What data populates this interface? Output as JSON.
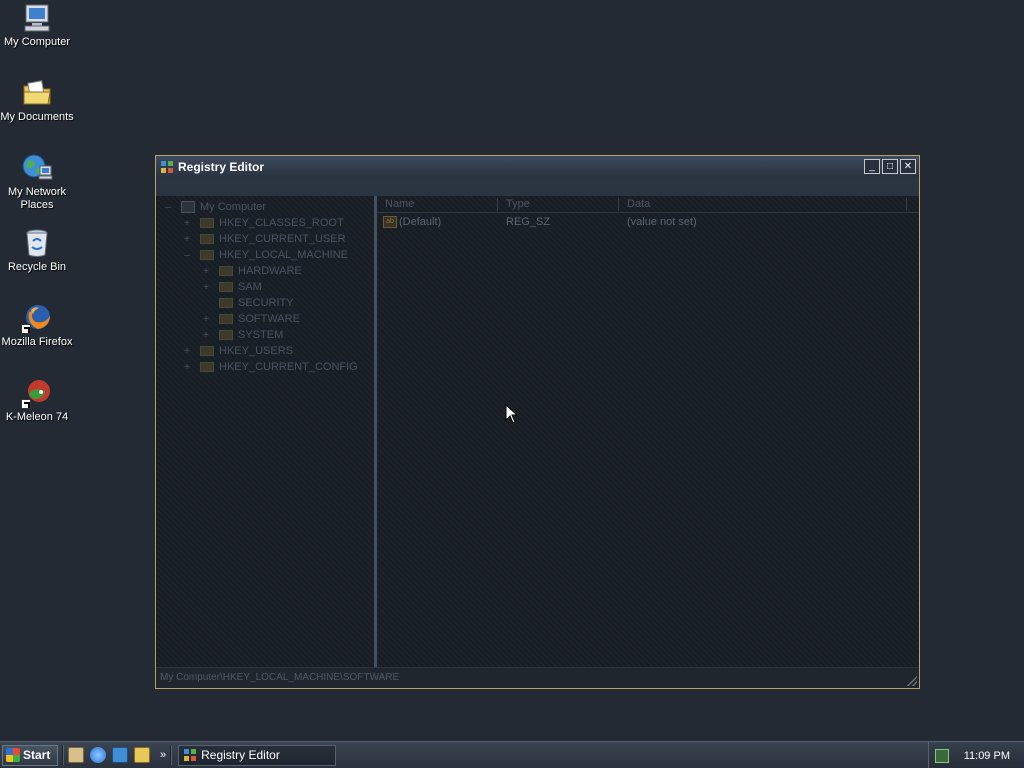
{
  "desktop": {
    "icons": [
      {
        "label": "My Computer",
        "icon": "my-computer-icon"
      },
      {
        "label": "My Documents",
        "icon": "my-documents-icon"
      },
      {
        "label": "My Network Places",
        "icon": "network-places-icon"
      },
      {
        "label": "Recycle Bin",
        "icon": "recycle-bin-icon"
      },
      {
        "label": "Mozilla Firefox",
        "icon": "firefox-icon"
      },
      {
        "label": "K-Meleon 74",
        "icon": "k-meleon-icon"
      }
    ]
  },
  "window": {
    "title": "Registry Editor",
    "controls": {
      "minimize": "_",
      "maximize": "□",
      "close": "✕"
    },
    "tree": [
      {
        "label": "My Computer",
        "expander": "–",
        "level": 0
      },
      {
        "label": "HKEY_CLASSES_ROOT",
        "expander": "+",
        "level": 1
      },
      {
        "label": "HKEY_CURRENT_USER",
        "expander": "+",
        "level": 1
      },
      {
        "label": "HKEY_LOCAL_MACHINE",
        "expander": "–",
        "level": 1
      },
      {
        "label": "HARDWARE",
        "expander": "+",
        "level": 2
      },
      {
        "label": "SAM",
        "expander": "+",
        "level": 2
      },
      {
        "label": "SECURITY",
        "expander": "",
        "level": 2
      },
      {
        "label": "SOFTWARE",
        "expander": "+",
        "level": 2
      },
      {
        "label": "SYSTEM",
        "expander": "+",
        "level": 2
      },
      {
        "label": "HKEY_USERS",
        "expander": "+",
        "level": 1
      },
      {
        "label": "HKEY_CURRENT_CONFIG",
        "expander": "+",
        "level": 1
      }
    ],
    "list": {
      "columns": [
        "Name",
        "Type",
        "Data"
      ],
      "rows": [
        {
          "name": "(Default)",
          "type": "REG_SZ",
          "data": "(value not set)"
        }
      ]
    },
    "status": "My Computer\\HKEY_LOCAL_MACHINE\\SOFTWARE"
  },
  "taskbar": {
    "start_label": "Start",
    "task_label": "Registry Editor",
    "chevron": "»",
    "clock": "11:09 PM"
  },
  "colors": {
    "desktop": "#232a33",
    "window_border": "#b8a26a",
    "titlebar": "#3d4b5e"
  }
}
